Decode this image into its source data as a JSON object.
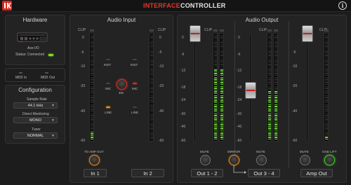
{
  "app": {
    "tabs": [
      {
        "label": "INTERFACE",
        "active": true
      },
      {
        "label": "CONTROLLER",
        "active": false
      }
    ],
    "info_icon": "info-icon",
    "logo_icon": "ik-logo-icon"
  },
  "hardware": {
    "title": "Hardware",
    "device_name": "Axe I/O",
    "status_label": "Status: Connected",
    "status_color": "#7ddb24",
    "midi_in_label": "MIDI In",
    "midi_out_label": "MIDI Out"
  },
  "configuration": {
    "title": "Configuration",
    "sample_rate_label": "Sample Rate",
    "sample_rate_value": "44.1 kHz",
    "direct_monitoring_label": "Direct Monitoring",
    "direct_monitoring_value": "MONO",
    "tuner_label": "Tuner",
    "tuner_value": "NORMAL"
  },
  "audio_input": {
    "title": "Audio Input",
    "clip_label": "CLIP",
    "scale": [
      "0",
      "-5",
      "-10",
      "-20",
      "-40",
      "-60"
    ],
    "inst_label": "INST",
    "mic_label": "MIC",
    "line_label": "LINE",
    "phantom_label": "48v",
    "to_amp_out_label": "TO AMP OUT",
    "in1_label": "In 1",
    "in2_label": "In 2",
    "in1_level": 0.08,
    "in2_level": 0.0
  },
  "audio_output": {
    "title": "Audio Output",
    "clip_label": "CLIP",
    "out12_scale": [
      "0",
      "-6",
      "-12",
      "-18",
      "-24",
      "-30",
      "-40",
      "-60"
    ],
    "out34_scale": [
      "0",
      "-6",
      "-12",
      "-18",
      "-24",
      "-30",
      "-40",
      "-60"
    ],
    "amp_scale": [
      "-5",
      "-10",
      "-20",
      "-40",
      "-60"
    ],
    "mute_label": "MUTE",
    "mirror_label": "MIRROR",
    "gnd_lift_label": "GND LIFT",
    "out12_label": "Out 1 - 2",
    "out34_label": "Out 3 - 4",
    "amp_out_label": "Amp Out",
    "out12_level": 0.68,
    "out34_level": 0.46,
    "amp_level": 0.04
  },
  "colors": {
    "accent": "#e8362a",
    "meter_on": "#6cd33a",
    "knob_red": "#e0301e",
    "knob_orange": "#e88a1a",
    "knob_green": "#43d12a"
  }
}
